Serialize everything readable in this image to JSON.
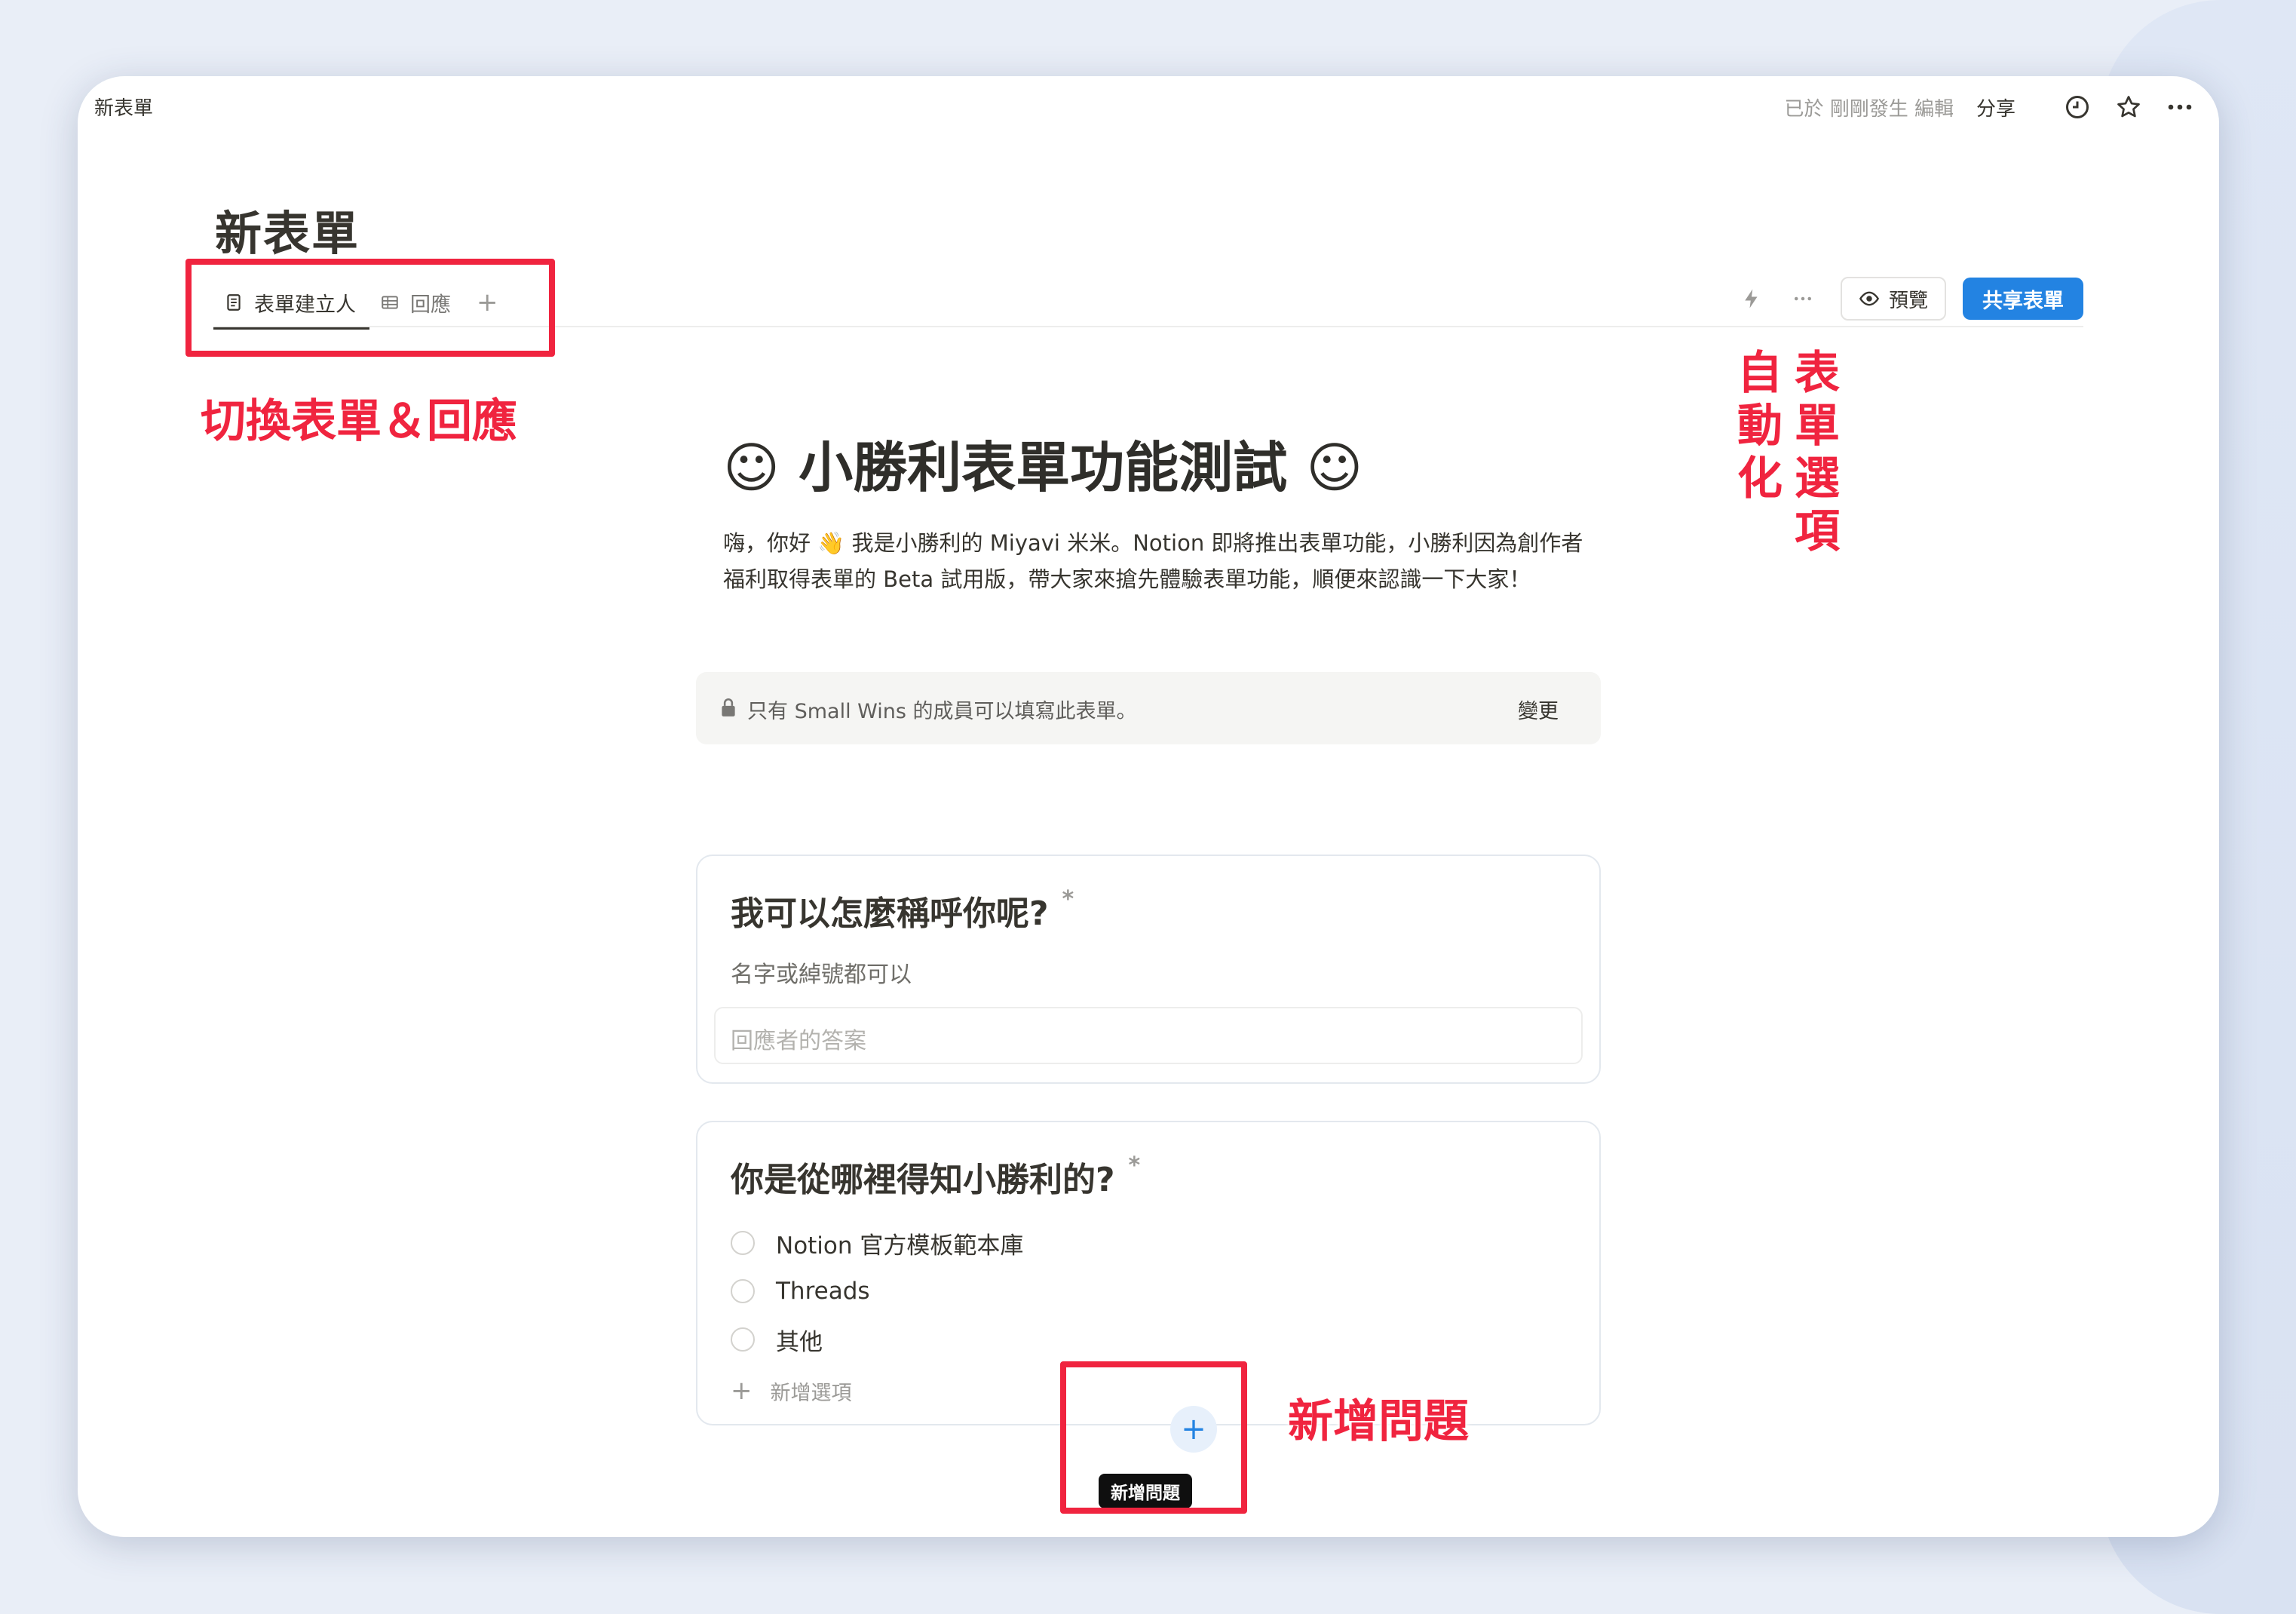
{
  "window": {
    "page_name": "新表單",
    "edited_status": "已於 剛剛發生 編輯",
    "share_label": "分享",
    "icons": [
      "clock-icon",
      "star-icon",
      "more-icon"
    ]
  },
  "header": {
    "title": "新表單",
    "tabs": [
      {
        "label": "表單建立人",
        "icon": "form-icon",
        "active": true
      },
      {
        "label": "回應",
        "icon": "table-icon",
        "active": false
      }
    ],
    "add_tab_icon": "plus-icon"
  },
  "toolbar": {
    "automation_icon": "lightning-icon",
    "more_icon": "more-icon",
    "preview_label": "預覽",
    "publish_label": "共享表單"
  },
  "form": {
    "title": "☺ 小勝利表單功能測試 ☺",
    "description": "嗨，你好 👋 我是小勝利的 Miyavi 米米。Notion 即將推出表單功能，小勝利因為創作者福利取得表單的 Beta 試用版，帶大家來搶先體驗表單功能，順便來認識一下大家！",
    "notice": {
      "text": "只有 Small Wins 的成員可以填寫此表單。",
      "change_label": "變更"
    },
    "questions": [
      {
        "title": "我可以怎麼稱呼你呢?",
        "required_mark": "*",
        "hint": "名字或綽號都可以",
        "answer_placeholder": "回應者的答案"
      },
      {
        "title": "你是從哪裡得知小勝利的?",
        "required_mark": "*",
        "options": [
          "Notion 官方模板範本庫",
          "Threads",
          "其他"
        ],
        "add_option_label": "新增選項"
      }
    ],
    "add_question_tooltip": "新增問題"
  },
  "annotations": {
    "tabs_label": "切換表單＆回應",
    "automation_label_col1": "自動化",
    "automation_label_col2": "表單選項",
    "add_question_label": "新增問題",
    "accent_color": "#f0243f"
  },
  "colors": {
    "primary_button": "#2383e2",
    "background": "#e9eef7"
  }
}
